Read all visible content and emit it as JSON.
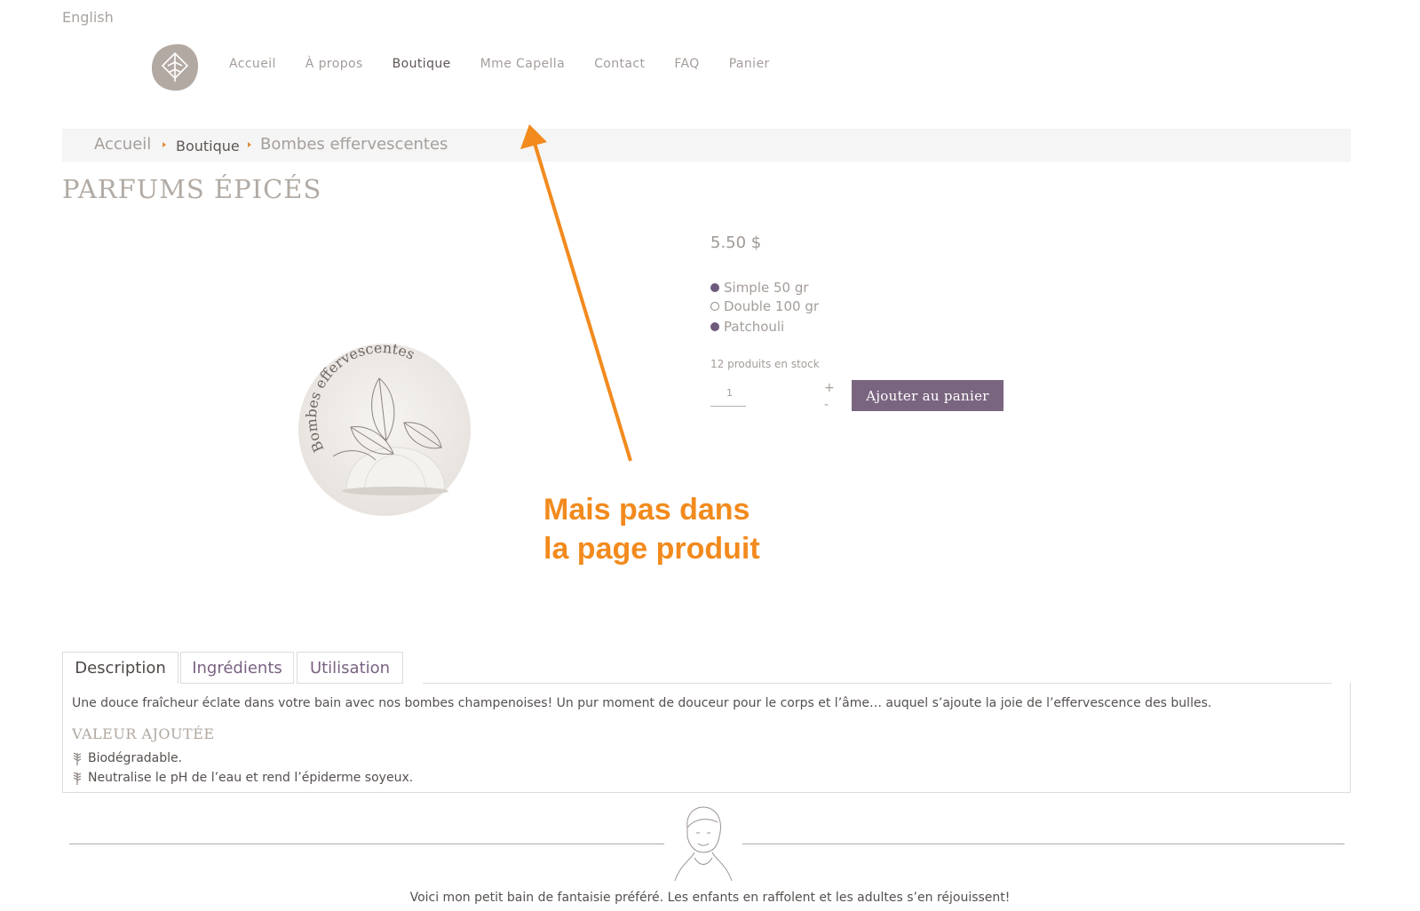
{
  "header": {
    "language_link": "English",
    "nav": [
      {
        "label": "Accueil"
      },
      {
        "label": "À propos"
      },
      {
        "label": "Boutique"
      },
      {
        "label": "Mme Capella"
      },
      {
        "label": "Contact"
      },
      {
        "label": "FAQ"
      },
      {
        "label": "Panier"
      }
    ],
    "active_nav": "Boutique"
  },
  "breadcrumb": {
    "home": "Accueil",
    "current": "Boutique",
    "category": "Bombes effervescentes"
  },
  "product": {
    "title": "PARFUMS ÉPICÉS",
    "image_label": "Bombes effervescentes",
    "price": "5.50 $",
    "options": [
      {
        "label": "Simple 50 gr",
        "selected": true
      },
      {
        "label": "Double 100 gr",
        "selected": false
      },
      {
        "label": "Patchouli",
        "selected": true
      }
    ],
    "stock": "12 produits en stock",
    "quantity": "1",
    "plus": "+",
    "minus": "-",
    "add_to_cart": "Ajouter au panier"
  },
  "annotation": {
    "line1": "Mais pas dans",
    "line2": "la page produit",
    "color": "#f28a1d"
  },
  "tabs": [
    {
      "label": "Description",
      "active": true
    },
    {
      "label": "Ingrédients",
      "active": false
    },
    {
      "label": "Utilisation",
      "active": false
    }
  ],
  "description": {
    "text": "Une douce fraîcheur éclate dans votre bain avec nos bombes champenoises! Un pur moment de douceur pour le corps et l’âme… auquel s’ajoute la joie de l’effervescence des bulles.",
    "value_title": "VALEUR AJOUTÉE",
    "bullets": [
      "Biodégradable.",
      "Neutralise le pH de l’eau et rend l’épiderme soyeux."
    ]
  },
  "footer": {
    "quote": "Voici mon petit bain de fantaisie préféré. Les enfants en raffolent et les adultes s’en réjouissent!"
  },
  "colors": {
    "accent_purple": "#7a6580",
    "muted_text": "#a49d9a",
    "breadcrumb_separator": "#e38a3a"
  }
}
